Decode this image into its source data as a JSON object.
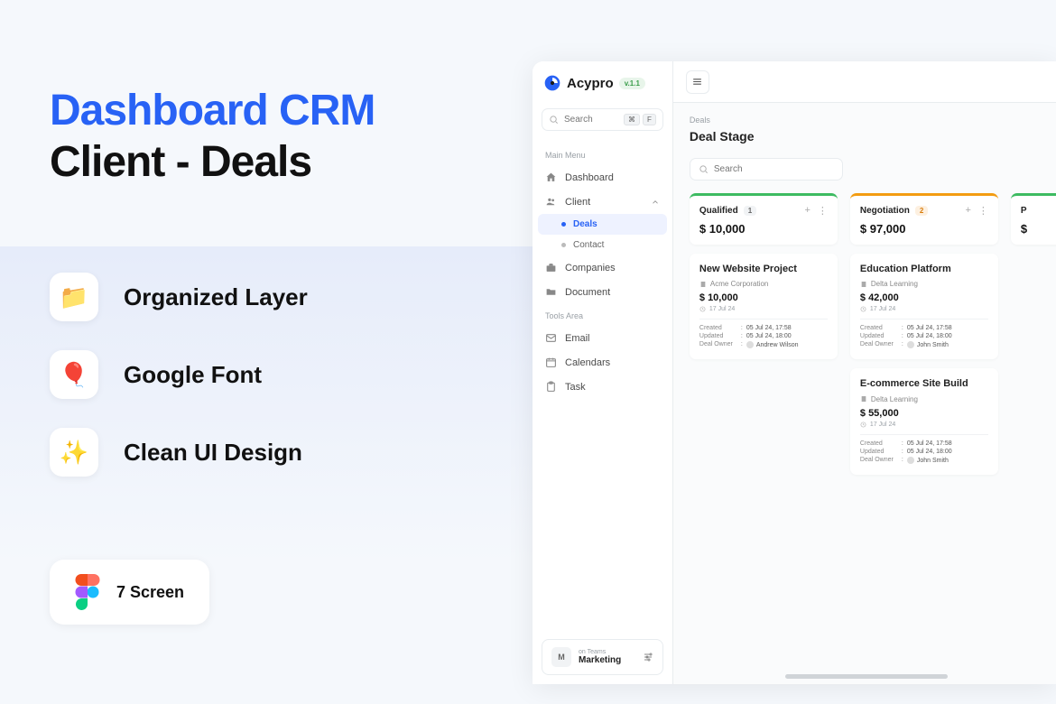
{
  "promo": {
    "title_line1": "Dashboard CRM",
    "title_line2": "Client - Deals",
    "features": [
      {
        "icon": "📁",
        "text": "Organized Layer"
      },
      {
        "icon": "🎈",
        "text": "Google Font"
      },
      {
        "icon": "✨",
        "text": "Clean UI Design"
      }
    ],
    "screens_badge": "7 Screen"
  },
  "app": {
    "brand": "Acypro",
    "version": "v.1.1",
    "search_placeholder": "Search",
    "kbd1": "⌘",
    "kbd2": "F",
    "sections": {
      "main_label": "Main Menu",
      "tools_label": "Tools Area"
    },
    "nav": {
      "dashboard": "Dashboard",
      "client": "Client",
      "deals": "Deals",
      "contact": "Contact",
      "companies": "Companies",
      "document": "Document",
      "email": "Email",
      "calendars": "Calendars",
      "task": "Task"
    },
    "teams": {
      "avatar_letter": "M",
      "label": "on Teams",
      "name": "Marketing"
    },
    "breadcrumb": "Deals",
    "page_title": "Deal Stage",
    "main_search_placeholder": "Search",
    "columns": [
      {
        "color": "green",
        "title": "Qualified",
        "count": "1",
        "total": "$ 10,000",
        "cards": [
          {
            "title": "New Website Project",
            "company": "Acme Corporation",
            "amount": "$ 10,000",
            "date": "17 Jul 24",
            "created": "05 Jul 24, 17:58",
            "updated": "05 Jul 24, 18:00",
            "owner": "Andrew Wilson"
          }
        ]
      },
      {
        "color": "orange",
        "title": "Negotiation",
        "count": "2",
        "total": "$ 97,000",
        "cards": [
          {
            "title": "Education Platform",
            "company": "Delta Learning",
            "amount": "$ 42,000",
            "date": "17 Jul 24",
            "created": "05 Jul 24, 17:58",
            "updated": "05 Jul 24, 18:00",
            "owner": "John Smith"
          },
          {
            "title": "E-commerce Site Build",
            "company": "Delta Learning",
            "amount": "$ 55,000",
            "date": "17 Jul 24",
            "created": "05 Jul 24, 17:58",
            "updated": "05 Jul 24, 18:00",
            "owner": "John Smith"
          }
        ]
      },
      {
        "color": "green",
        "title": "P",
        "count": "",
        "total": "$",
        "cards": []
      }
    ],
    "meta_labels": {
      "created": "Created",
      "updated": "Updated",
      "owner": "Deal Owner"
    }
  }
}
